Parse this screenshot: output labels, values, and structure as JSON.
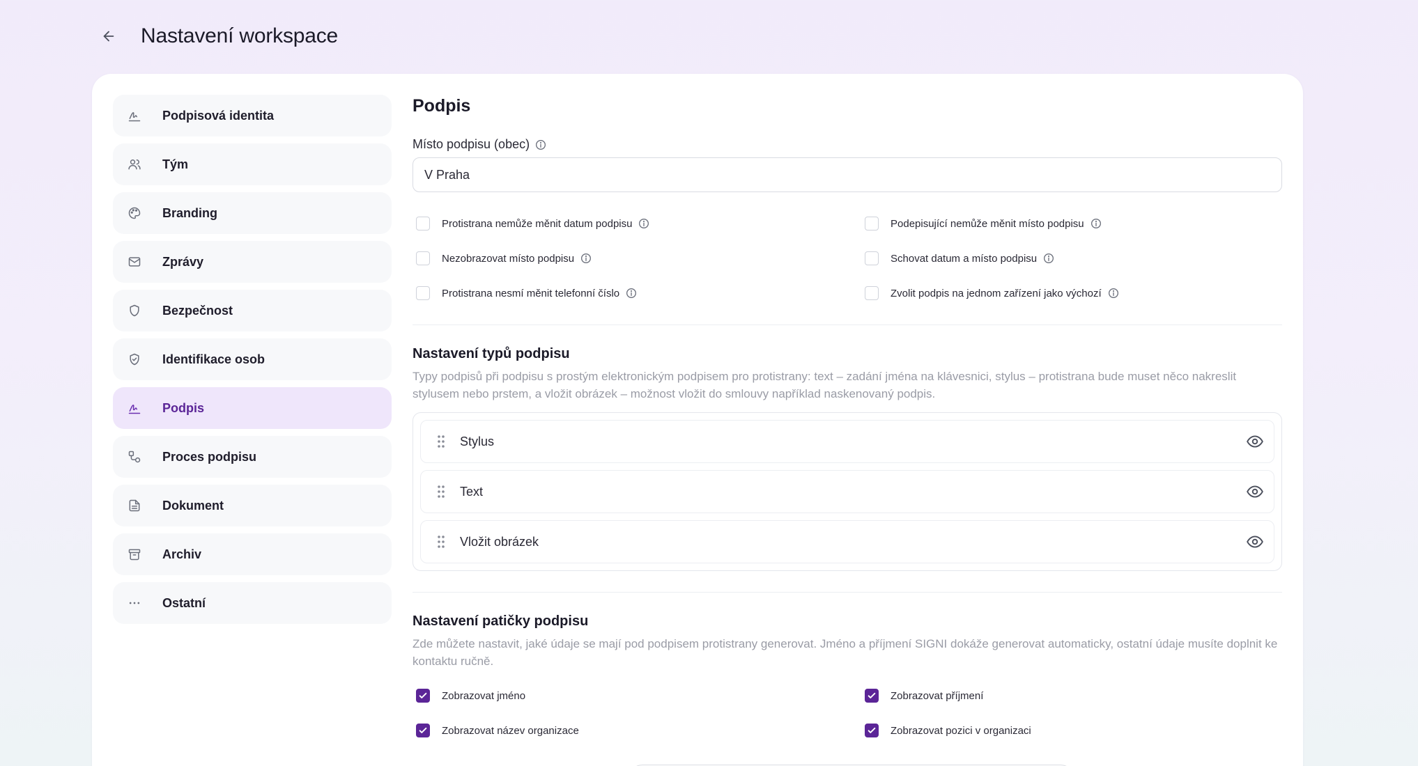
{
  "header": {
    "title": "Nastavení workspace"
  },
  "sidebar": {
    "items": [
      {
        "label": "Podpisová identita",
        "icon": "signature-icon"
      },
      {
        "label": "Tým",
        "icon": "users-icon"
      },
      {
        "label": "Branding",
        "icon": "palette-icon"
      },
      {
        "label": "Zprávy",
        "icon": "mail-icon"
      },
      {
        "label": "Bezpečnost",
        "icon": "shield-icon"
      },
      {
        "label": "Identifikace osob",
        "icon": "shield-check-icon"
      },
      {
        "label": "Podpis",
        "icon": "signature-icon",
        "active": true
      },
      {
        "label": "Proces podpisu",
        "icon": "workflow-icon"
      },
      {
        "label": "Dokument",
        "icon": "document-icon"
      },
      {
        "label": "Archiv",
        "icon": "archive-icon"
      },
      {
        "label": "Ostatní",
        "icon": "more-icon"
      }
    ]
  },
  "main": {
    "title": "Podpis",
    "place": {
      "label": "Místo podpisu (obec)",
      "value": "V Praha"
    },
    "options": [
      {
        "label": "Protistrana nemůže měnit datum podpisu",
        "checked": false
      },
      {
        "label": "Podepisující nemůže měnit místo podpisu",
        "checked": false
      },
      {
        "label": "Nezobrazovat místo podpisu",
        "checked": false
      },
      {
        "label": "Schovat datum a místo podpisu",
        "checked": false
      },
      {
        "label": "Protistrana nesmí měnit telefonní číslo",
        "checked": false
      },
      {
        "label": "Zvolit podpis na jednom zařízení jako výchozí",
        "checked": false
      }
    ],
    "types": {
      "title": "Nastavení typů podpisu",
      "description": "Typy podpisů při podpisu s prostým elektronickým podpisem pro protistrany: text – zadání jména na klávesnici, stylus – protistrana bude muset něco nakreslit stylusem nebo prstem, a vložit obrázek – možnost vložit do smlouvy například naskenovaný podpis.",
      "items": [
        {
          "label": "Stylus"
        },
        {
          "label": "Text"
        },
        {
          "label": "Vložit obrázek"
        }
      ]
    },
    "footer": {
      "title": "Nastavení patičky podpisu",
      "description": "Zde můžete nastavit, jaké údaje se mají pod podpisem protistrany generovat. Jméno a příjmení SIGNI dokáže generovat automaticky, ostatní údaje musíte doplnit ke kontaktu ručně.",
      "options": [
        {
          "label": "Zobrazovat jméno",
          "checked": true
        },
        {
          "label": "Zobrazovat příjmení",
          "checked": true
        },
        {
          "label": "Zobrazovat název organizace",
          "checked": true
        },
        {
          "label": "Zobrazovat pozici v organizaci",
          "checked": true
        }
      ]
    }
  },
  "colors": {
    "accent": "#5b2597",
    "active_bg": "#efe6fb",
    "background": "#f1ebfa"
  }
}
